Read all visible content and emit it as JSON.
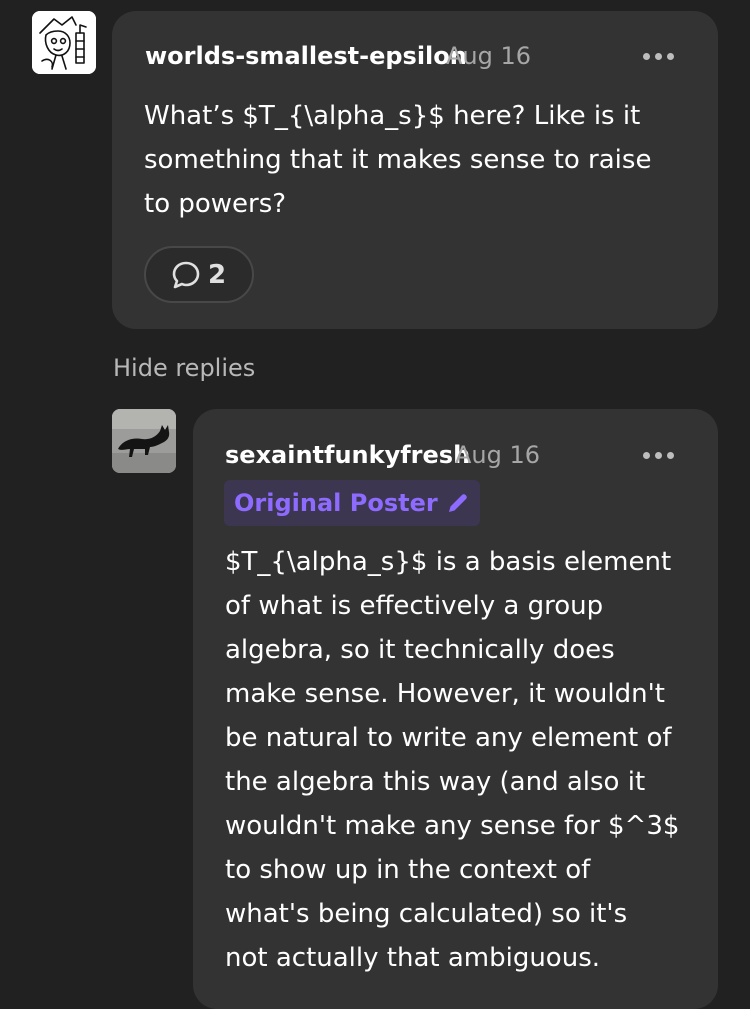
{
  "comment": {
    "username": "worlds-smallest-epsilon",
    "date": "Aug 16",
    "body_lines": [
      "What’s $T_{\\alpha_s}$ here? Like is it",
      "something that it makes sense to raise",
      "to powers?"
    ],
    "reply_count": "2",
    "more_icon": "ellipsis-icon",
    "reply_icon": "speech-bubble-icon"
  },
  "hide_replies_label": "Hide replies",
  "reply": {
    "username": "sexaintfunkyfresh",
    "date": "Aug 16",
    "badge_label": "Original Poster",
    "badge_icon": "pencil-icon",
    "body_lines": [
      "$T_{\\alpha_s}$ is a basis element",
      "of what is effectively a group",
      "algebra, so it technically does",
      "make sense. However, it wouldn't",
      "be natural to write any element of",
      "the algebra this way (and also it",
      "wouldn't make any sense for $^3$",
      "to show up in the context of",
      "what's being calculated) so it's",
      "not actually that ambiguous."
    ],
    "more_icon": "ellipsis-icon"
  },
  "colors": {
    "background": "#212121",
    "card": "#333333",
    "accent_purple": "#8e6bff",
    "badge_bg": "#3d3650",
    "muted_text": "#a6a6a6"
  }
}
